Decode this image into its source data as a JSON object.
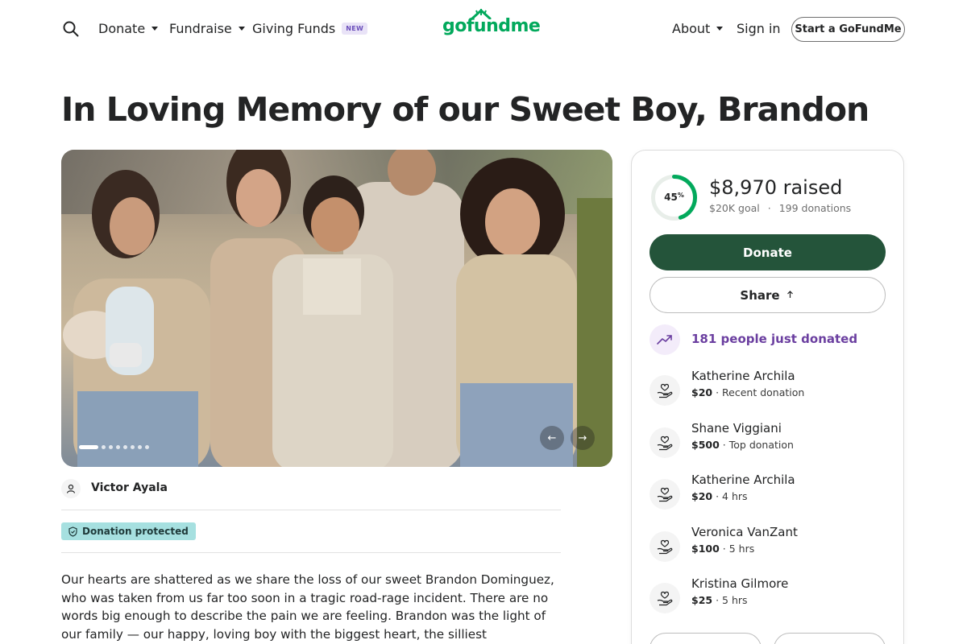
{
  "header": {
    "nav": {
      "donate": "Donate",
      "fundraise": "Fundraise",
      "giving_funds": "Giving Funds",
      "giving_funds_badge": "NEW",
      "about": "About",
      "sign_in": "Sign in",
      "start": "Start a GoFundMe"
    },
    "logo": "gofundme"
  },
  "campaign": {
    "title": "In Loving Memory of our Sweet Boy, Brandon",
    "organizer": "Victor Ayala",
    "protected_label": "Donation protected",
    "story": "Our hearts are shattered as we share the loss of our sweet Brandon Dominguez, who was taken from us far too soon in a tragic road-rage incident. There are no words big enough to describe the pain we are feeling. Brandon was the light of our family — our happy, loving boy with the biggest heart, the silliest personality, and a joy that filled every room",
    "photo_count": 8,
    "photo_active_index": 0,
    "prev_arrow": "←",
    "next_arrow": "→"
  },
  "progress": {
    "percent": 45,
    "percent_text": "45",
    "percent_sign": "%",
    "raised": "$8,970 raised",
    "goal": "$20K goal",
    "separator": "·",
    "donations": "199 donations",
    "ring_color": "#02a95c",
    "ring_track_color": "#e8eee9"
  },
  "actions": {
    "donate": "Donate",
    "share": "Share"
  },
  "activity": {
    "trend_text": "181 people just donated",
    "donations": [
      {
        "name": "Katherine Archila",
        "amount": "$20",
        "meta": "Recent donation"
      },
      {
        "name": "Shane Viggiani",
        "amount": "$500",
        "meta": "Top donation"
      },
      {
        "name": "Katherine Archila",
        "amount": "$20",
        "meta": "4 hrs"
      },
      {
        "name": "Veronica VanZant",
        "amount": "$100",
        "meta": "5 hrs"
      },
      {
        "name": "Kristina Gilmore",
        "amount": "$25",
        "meta": "5 hrs"
      }
    ]
  },
  "colors": {
    "brand_green": "#02a95c",
    "donate_button": "#24543a",
    "trend_purple": "#6b3fa0",
    "protected_badge": "#a6e0e0"
  }
}
